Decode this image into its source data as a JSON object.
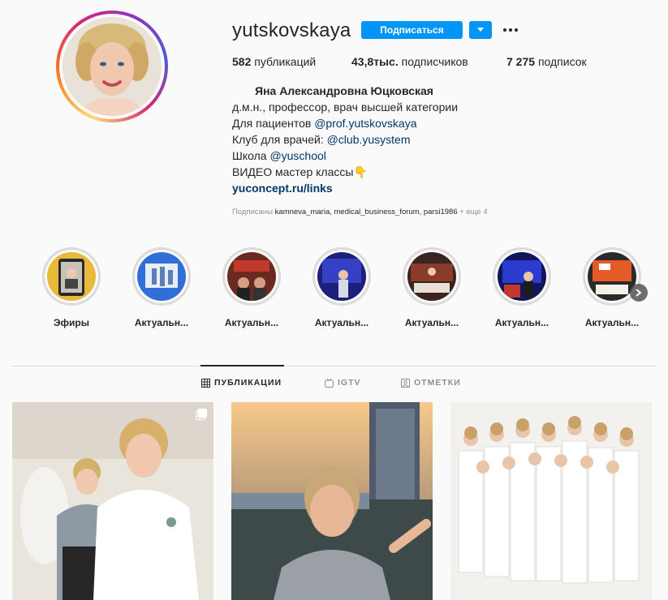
{
  "profile": {
    "username": "yutskovskaya",
    "follow_label": "Подписаться",
    "stats": {
      "posts_count": "582",
      "posts_label": "публикаций",
      "followers_count": "43,8тыс.",
      "followers_label": "подписчиков",
      "following_count": "7 275",
      "following_label": "подписок"
    },
    "bio": {
      "full_name": "Яна Александровна Юцковская",
      "line1": "д.м.н., профессор, врач высшей категории",
      "line2_prefix": "Для пациентов ",
      "line2_link": "@prof.yutskovskaya",
      "line3_prefix": "Клуб для врачей: ",
      "line3_link": "@club.yusystem",
      "line4_prefix": "Школа ",
      "line4_link": "@yuschool",
      "line5": "ВИДЕО мастер классы",
      "line5_emoji": "👇",
      "website": "yuconcept.ru/links"
    },
    "followed_by": {
      "prefix": "Подписаны ",
      "names": "kamneva_maria, medical_business_forum, parsi1986",
      "suffix": " + еще 4"
    }
  },
  "highlights": [
    {
      "label": "Эфиры"
    },
    {
      "label": "Актуальн..."
    },
    {
      "label": "Актуальн..."
    },
    {
      "label": "Актуальн..."
    },
    {
      "label": "Актуальн..."
    },
    {
      "label": "Актуальн..."
    },
    {
      "label": "Актуальн..."
    }
  ],
  "tabs": [
    {
      "label": "ПУБЛИКАЦИИ",
      "icon": "grid-icon",
      "active": true
    },
    {
      "label": "IGTV",
      "icon": "igtv-icon",
      "active": false
    },
    {
      "label": "ОТМЕТКИ",
      "icon": "tagged-icon",
      "active": false
    }
  ],
  "posts": [
    {
      "icon": "multiple-photos-icon"
    },
    {},
    {}
  ],
  "colors": {
    "accent": "#0095f6",
    "link": "#00376b",
    "muted": "#8e8e8e",
    "text": "#262626"
  }
}
